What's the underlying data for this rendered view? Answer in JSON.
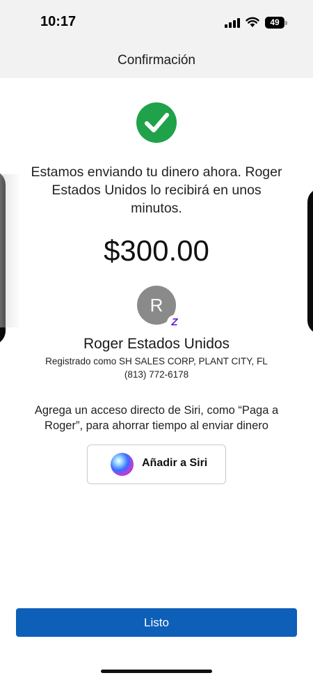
{
  "status_bar": {
    "time": "10:17",
    "battery": "49"
  },
  "header": {
    "title": "Confirmación"
  },
  "confirmation": {
    "message": "Estamos enviando tu dinero ahora. Roger Estados Unidos lo recibirá en unos minutos.",
    "amount": "$300.00"
  },
  "recipient": {
    "initial": "R",
    "badge": "Z",
    "name": "Roger Estados Unidos",
    "registered": "Registrado como SH SALES CORP, PLANT CITY, FL",
    "phone": "(813) 772-6178"
  },
  "siri": {
    "description": "Agrega un acceso directo de Siri, como “Paga a Roger”, para ahorrar tiempo al enviar dinero",
    "button_label": "Añadir a Siri"
  },
  "footer": {
    "done_label": "Listo"
  },
  "colors": {
    "primary_button": "#0d5fb8",
    "success_green": "#1fa24a",
    "zelle_purple": "#6d1ed4",
    "avatar_gray": "#8a8a8a"
  },
  "icons": [
    "signal-icon",
    "wifi-icon",
    "battery-icon",
    "check-circle-icon",
    "zelle-icon",
    "siri-icon"
  ]
}
